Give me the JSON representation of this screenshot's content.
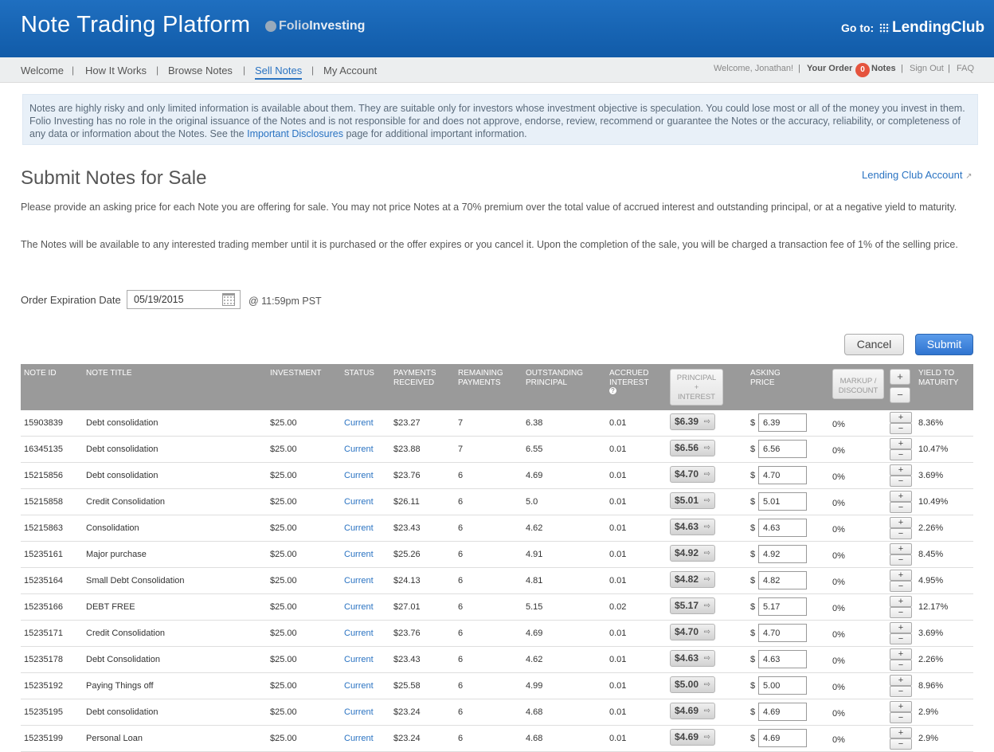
{
  "header": {
    "title": "Note Trading Platform",
    "folio_part1": "Folio",
    "folio_part2": "Investing",
    "goto_label": "Go to:",
    "lendingclub": "LendingClub"
  },
  "nav": {
    "items": [
      {
        "label": "Welcome"
      },
      {
        "label": "How It Works"
      },
      {
        "label": "Browse Notes"
      },
      {
        "label": "Sell Notes",
        "active": true
      },
      {
        "label": "My Account"
      }
    ],
    "separator": "|",
    "welcome": "Welcome, Jonathan!",
    "your_order": "Your Order",
    "order_count": "0",
    "notes": "Notes",
    "sign_out": "Sign Out",
    "faq": "FAQ"
  },
  "disclaimer": {
    "text_before": "Notes are highly risky and only limited information is available about them. They are suitable only for investors whose investment objective is speculation. You could lose most or all of the money you invest in them. Folio Investing has no role in the original issuance of the Notes and is not responsible for and does not approve, endorse, review, recommend or guarantee the Notes or the accuracy, reliability, or completeness of any data or information about the Notes. See the ",
    "link": "Important Disclosures",
    "text_after": " page for additional important information."
  },
  "page": {
    "title": "Submit Notes for Sale",
    "account_link": "Lending Club Account",
    "para1": "Please provide an asking price for each Note you are offering for sale. You may not price Notes at a 70% premium over the total value of accrued interest and outstanding principal, or at a negative yield to maturity.",
    "para2": "The Notes will be available to any interested trading member until it is purchased or the offer expires or you cancel it. Upon the completion of the sale, you will be charged a transaction fee of 1% of the selling price.",
    "expiration_label": "Order Expiration Date",
    "expiration_value": "05/19/2015",
    "expiration_time": "@ 11:59pm PST",
    "cancel": "Cancel",
    "submit": "Submit"
  },
  "table": {
    "headers": {
      "note_id": "NOTE ID",
      "note_title": "NOTE TITLE",
      "investment": "INVESTMENT",
      "status": "STATUS",
      "payments_received": "PAYMENTS RECEIVED",
      "remaining_payments": "REMAINING PAYMENTS",
      "outstanding_principal": "OUTSTANDING PRINCIPAL",
      "accrued_interest": "ACCRUED INTEREST",
      "principal_interest_1": "PRINCIPAL",
      "principal_interest_2": "+",
      "principal_interest_3": "INTEREST",
      "asking_price": "ASKING PRICE",
      "markup_discount": "MARKUP / DISCOUNT",
      "yield_to_maturity": "YIELD TO MATURITY"
    },
    "rows": [
      {
        "id": "15903839",
        "title": "Debt consolidation",
        "investment": "$25.00",
        "status": "Current",
        "received": "$23.27",
        "remaining": "7",
        "outstanding": "6.38",
        "accrued": "0.01",
        "pi": "$6.39",
        "ask": "6.39",
        "markup": "0%",
        "yield": "8.36%"
      },
      {
        "id": "16345135",
        "title": "Debt consolidation",
        "investment": "$25.00",
        "status": "Current",
        "received": "$23.88",
        "remaining": "7",
        "outstanding": "6.55",
        "accrued": "0.01",
        "pi": "$6.56",
        "ask": "6.56",
        "markup": "0%",
        "yield": "10.47%"
      },
      {
        "id": "15215856",
        "title": "Debt consolidation",
        "investment": "$25.00",
        "status": "Current",
        "received": "$23.76",
        "remaining": "6",
        "outstanding": "4.69",
        "accrued": "0.01",
        "pi": "$4.70",
        "ask": "4.70",
        "markup": "0%",
        "yield": "3.69%"
      },
      {
        "id": "15215858",
        "title": "Credit Consolidation",
        "investment": "$25.00",
        "status": "Current",
        "received": "$26.11",
        "remaining": "6",
        "outstanding": "5.0",
        "accrued": "0.01",
        "pi": "$5.01",
        "ask": "5.01",
        "markup": "0%",
        "yield": "10.49%"
      },
      {
        "id": "15215863",
        "title": "Consolidation",
        "investment": "$25.00",
        "status": "Current",
        "received": "$23.43",
        "remaining": "6",
        "outstanding": "4.62",
        "accrued": "0.01",
        "pi": "$4.63",
        "ask": "4.63",
        "markup": "0%",
        "yield": "2.26%"
      },
      {
        "id": "15235161",
        "title": "Major purchase",
        "investment": "$25.00",
        "status": "Current",
        "received": "$25.26",
        "remaining": "6",
        "outstanding": "4.91",
        "accrued": "0.01",
        "pi": "$4.92",
        "ask": "4.92",
        "markup": "0%",
        "yield": "8.45%"
      },
      {
        "id": "15235164",
        "title": "Small Debt Consolidation",
        "investment": "$25.00",
        "status": "Current",
        "received": "$24.13",
        "remaining": "6",
        "outstanding": "4.81",
        "accrued": "0.01",
        "pi": "$4.82",
        "ask": "4.82",
        "markup": "0%",
        "yield": "4.95%"
      },
      {
        "id": "15235166",
        "title": "DEBT FREE",
        "investment": "$25.00",
        "status": "Current",
        "received": "$27.01",
        "remaining": "6",
        "outstanding": "5.15",
        "accrued": "0.02",
        "pi": "$5.17",
        "ask": "5.17",
        "markup": "0%",
        "yield": "12.17%"
      },
      {
        "id": "15235171",
        "title": "Credit Consolidation",
        "investment": "$25.00",
        "status": "Current",
        "received": "$23.76",
        "remaining": "6",
        "outstanding": "4.69",
        "accrued": "0.01",
        "pi": "$4.70",
        "ask": "4.70",
        "markup": "0%",
        "yield": "3.69%"
      },
      {
        "id": "15235178",
        "title": "Debt Consolidation",
        "investment": "$25.00",
        "status": "Current",
        "received": "$23.43",
        "remaining": "6",
        "outstanding": "4.62",
        "accrued": "0.01",
        "pi": "$4.63",
        "ask": "4.63",
        "markup": "0%",
        "yield": "2.26%"
      },
      {
        "id": "15235192",
        "title": "Paying Things off",
        "investment": "$25.00",
        "status": "Current",
        "received": "$25.58",
        "remaining": "6",
        "outstanding": "4.99",
        "accrued": "0.01",
        "pi": "$5.00",
        "ask": "5.00",
        "markup": "0%",
        "yield": "8.96%"
      },
      {
        "id": "15235195",
        "title": "Debt consolidation",
        "investment": "$25.00",
        "status": "Current",
        "received": "$23.24",
        "remaining": "6",
        "outstanding": "4.68",
        "accrued": "0.01",
        "pi": "$4.69",
        "ask": "4.69",
        "markup": "0%",
        "yield": "2.9%"
      },
      {
        "id": "15235199",
        "title": "Personal Loan",
        "investment": "$25.00",
        "status": "Current",
        "received": "$23.24",
        "remaining": "6",
        "outstanding": "4.68",
        "accrued": "0.01",
        "pi": "$4.69",
        "ask": "4.69",
        "markup": "0%",
        "yield": "2.9%"
      }
    ]
  }
}
